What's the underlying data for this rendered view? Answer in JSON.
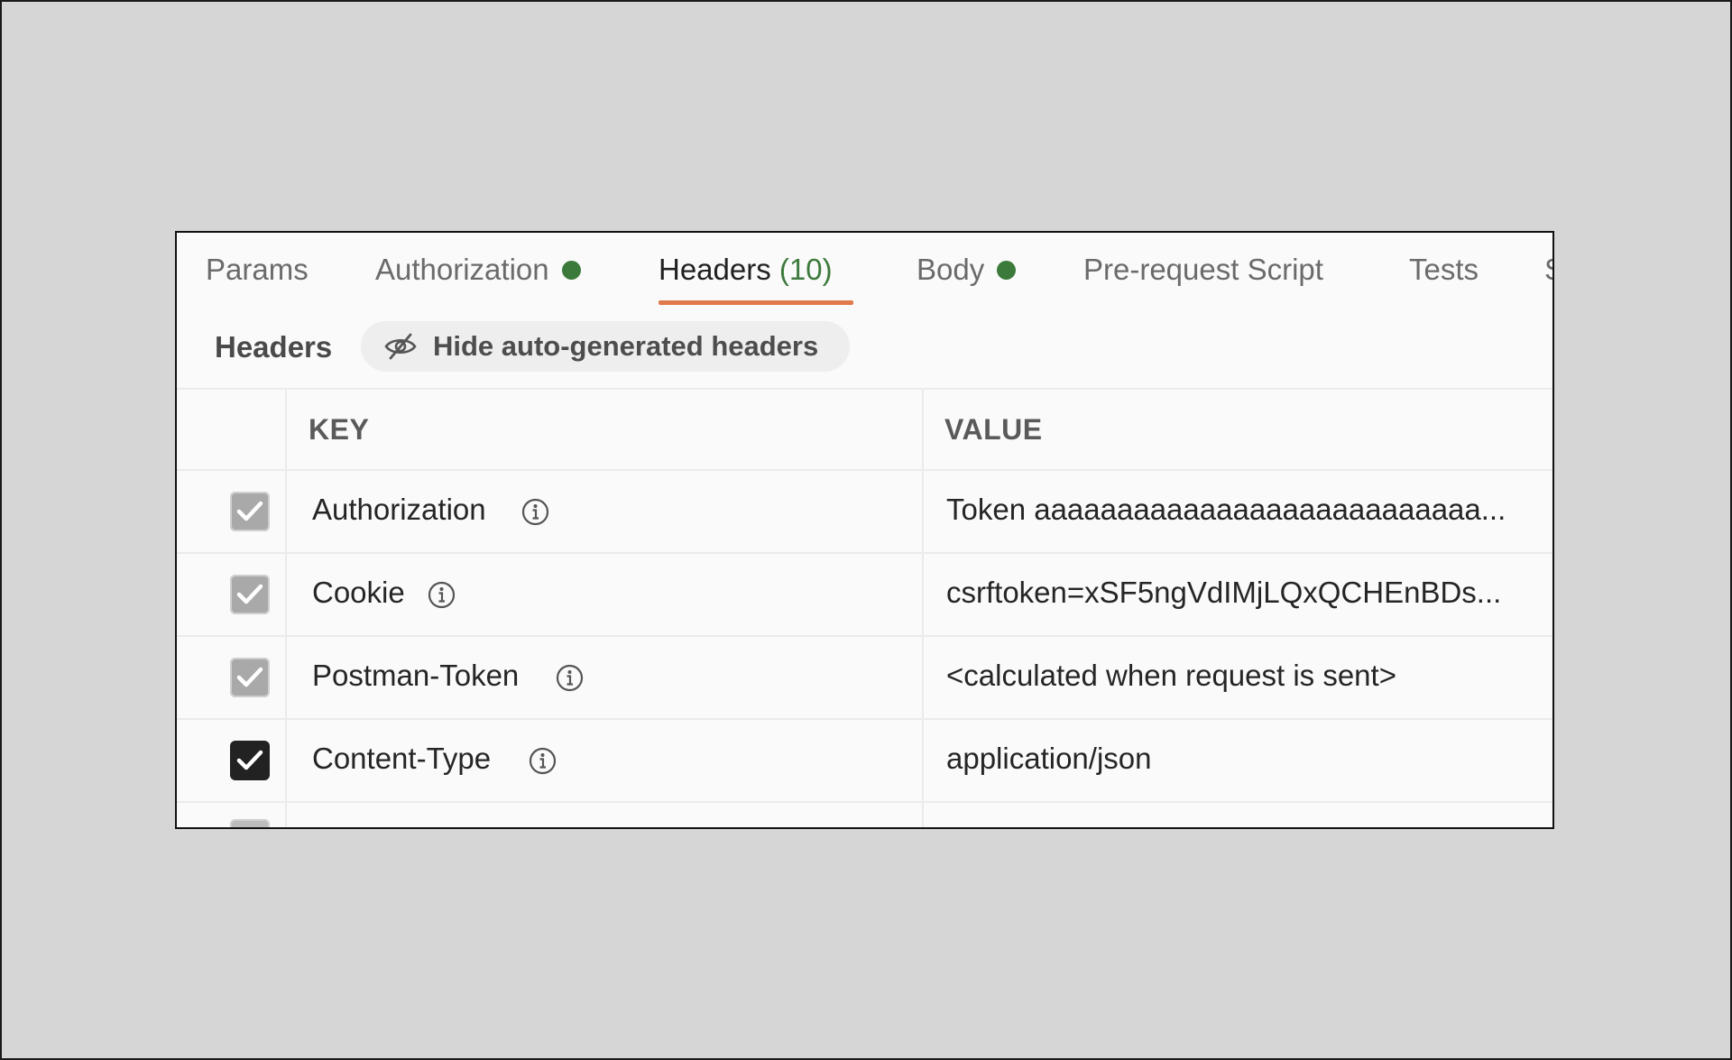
{
  "tabs": [
    {
      "label": "Params"
    },
    {
      "label": "Authorization",
      "dot": true
    },
    {
      "label": "Headers",
      "count": "(10)",
      "active": true
    },
    {
      "label": "Body",
      "dot": true
    },
    {
      "label": "Pre-request Script"
    },
    {
      "label": "Tests"
    }
  ],
  "subheader": {
    "title": "Headers",
    "hide_button_label": "Hide auto-generated headers"
  },
  "table": {
    "columns": {
      "key": "KEY",
      "value": "VALUE"
    },
    "rows": [
      {
        "key": "Authorization",
        "value": "Token aaaaaaaaaaaaaaaaaaaaaaaaaaa...",
        "checked": true,
        "auto": true
      },
      {
        "key": "Cookie",
        "value": "csrftoken=xSF5ngVdIMjLQxQCHEnBDs...",
        "checked": true,
        "auto": true
      },
      {
        "key": "Postman-Token",
        "value": "<calculated when request is sent>",
        "checked": true,
        "auto": true
      },
      {
        "key": "Content-Type",
        "value": "application/json",
        "checked": true,
        "auto": false
      }
    ]
  },
  "colors": {
    "accent_underline": "#e07a4a",
    "status_dot": "#3b7a3b",
    "count_text": "#3d7a3d"
  }
}
